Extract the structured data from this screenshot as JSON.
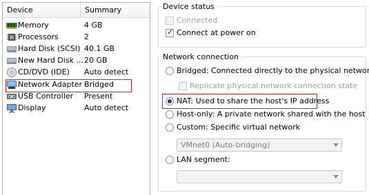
{
  "device_list": {
    "header_device": "Device",
    "header_summary": "Summary",
    "rows": [
      {
        "name": "Memory",
        "summary": "4 GB",
        "icon": "memory-icon"
      },
      {
        "name": "Processors",
        "summary": "2",
        "icon": "processor-icon"
      },
      {
        "name": "Hard Disk (SCSI)",
        "summary": "40.1 GB",
        "icon": "hard-disk-icon"
      },
      {
        "name": "New Hard Disk ...",
        "summary": "20 GB",
        "icon": "hard-disk-icon"
      },
      {
        "name": "CD/DVD (IDE)",
        "summary": "Auto detect",
        "icon": "cd-dvd-icon"
      },
      {
        "name": "Network Adapter",
        "summary": "Bridged",
        "icon": "network-adapter-icon"
      },
      {
        "name": "USB Controller",
        "summary": "Present",
        "icon": "usb-icon"
      },
      {
        "name": "Display",
        "summary": "Auto detect",
        "icon": "display-icon"
      }
    ]
  },
  "device_status": {
    "title": "Device status",
    "connected_label": "Connected",
    "connect_at_power_on_label": "Connect at power on"
  },
  "network_connection": {
    "title": "Network connection",
    "bridged_label": "Bridged: Connected directly to the physical network",
    "replicate_label": "Replicate physical network connection state",
    "nat_label": "NAT: Used to share the host's IP address",
    "host_only_label": "Host-only: A private network shared with the host",
    "custom_label": "Custom: Specific virtual network",
    "vmnet_value": "VMnet0 (Auto-bridging)",
    "lan_segment_label": "LAN segment:",
    "lan_value": ""
  },
  "colors": {
    "highlight_border": "#cc2222",
    "radio_dot": "#1f3c91"
  }
}
